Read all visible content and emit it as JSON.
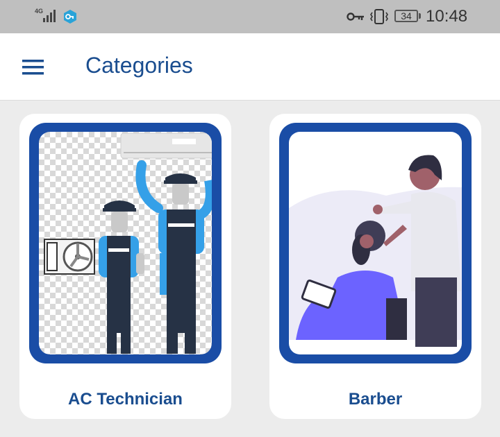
{
  "status_bar": {
    "network_type": "4G",
    "battery_level": "34",
    "time": "10:48",
    "icons": [
      "signal-icon",
      "vpn-icon",
      "key-icon",
      "vibrate-icon",
      "battery-icon"
    ]
  },
  "app_bar": {
    "title": "Categories",
    "menu_icon": "hamburger-menu-icon"
  },
  "categories": [
    {
      "label": "AC Technician",
      "illustration": "ac-technician-illustration"
    },
    {
      "label": "Barber",
      "illustration": "barber-illustration"
    }
  ],
  "colors": {
    "accent": "#1a4da6",
    "title_text": "#1a4d8f",
    "status_bar_bg": "#bfbfbf",
    "page_bg": "#ececec"
  }
}
